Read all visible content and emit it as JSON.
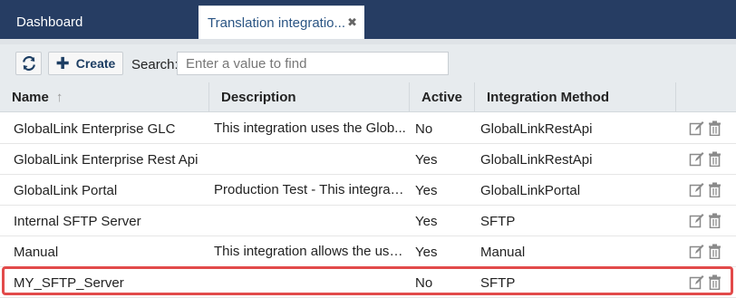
{
  "tabs": {
    "dashboard": "Dashboard",
    "active": "Translation integratio...",
    "close_glyph": "✖"
  },
  "toolbar": {
    "refresh_icon": "refresh-icon",
    "create_label": "Create",
    "search_label": "Search:",
    "search_placeholder": "Enter a value to find"
  },
  "grid": {
    "columns": [
      "Name",
      "Description",
      "Active",
      "Integration Method"
    ],
    "sort_indicator": "↑",
    "rows": [
      {
        "name": "GlobalLink Enterprise GLC",
        "description": "This integration uses the Glob...",
        "active": "No",
        "method": "GlobalLinkRestApi"
      },
      {
        "name": "GlobalLink Enterprise Rest Api",
        "description": "",
        "active": "Yes",
        "method": "GlobalLinkRestApi"
      },
      {
        "name": "GlobalLink Portal",
        "description": "Production Test - This integrati...",
        "active": "Yes",
        "method": "GlobalLinkPortal"
      },
      {
        "name": "Internal SFTP Server",
        "description": "",
        "active": "Yes",
        "method": "SFTP"
      },
      {
        "name": "Manual",
        "description": "This integration allows the use...",
        "active": "Yes",
        "method": "Manual"
      },
      {
        "name": "MY_SFTP_Server",
        "description": "",
        "active": "No",
        "method": "SFTP"
      }
    ],
    "row_action_icons": [
      "edit-icon",
      "trash-icon"
    ]
  },
  "colors": {
    "tabbar": "#263d63",
    "highlight": "#e24a4a",
    "accent_text": "#2b5584"
  }
}
